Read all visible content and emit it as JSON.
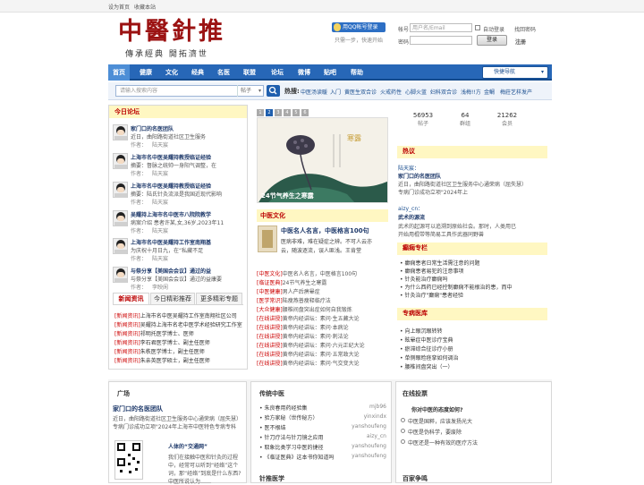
{
  "topbar": {
    "set_home": "设为首页",
    "bookmark": "收藏本站"
  },
  "logo": {
    "main": "中醫針推",
    "slogan": "傳承經典 開拓濟世"
  },
  "login": {
    "qq_button": "用QQ帐号登录",
    "qq_note": "只需一步，快速开始",
    "account_label": "帐号",
    "account_placeholder": "用户名/Email",
    "auto_login": "自动登录",
    "find_password": "找回密码",
    "password_label": "密码",
    "login_button": "登录",
    "register": "注册"
  },
  "nav": {
    "items": [
      "首页",
      "健康",
      "文化",
      "经典",
      "名医",
      "联盟",
      "论坛",
      "微博",
      "贴吧",
      "帮助"
    ],
    "quick_nav": "快捷导航"
  },
  "search": {
    "placeholder": "请输入搜索内容",
    "scope": "帖子",
    "hot_label": "热搜:",
    "hot_words": [
      "中医汤读暖",
      "入门",
      "黄医生双合诊",
      "火戒药性",
      "心脚火蓝",
      "妇科双合诊",
      "浅梅!!方",
      "金鲷",
      "梅莊艺样发产"
    ]
  },
  "today_forum": {
    "title": "今日论坛",
    "posts": [
      {
        "title": "家门口的名医团队",
        "summary": "近日，曲阳路街道社区卫生服务",
        "author_label": "作者：",
        "author": "陆天宸"
      },
      {
        "title": "上海市名中医吴耀持教授临证经验",
        "summary": "摘要：督脉之统帅一身阳气调整，在",
        "author_label": "作者：",
        "author": "陆天宸"
      },
      {
        "title": "上海市名中医吴耀持教授临证经验",
        "summary": "摘要：陆氏针灸流派是我国近现代影响",
        "author_label": "作者：",
        "author": "陆天宸"
      },
      {
        "title": "吴耀持上海市名中医市八院院教学",
        "summary": "病案介绍 患者许某,女,36岁,2023年11",
        "author_label": "作者：",
        "author": "陆天宸"
      },
      {
        "title": "上海市名中医吴耀持工作室南翔基",
        "summary": "为庆祝十月日九，在“私藏不足",
        "author_label": "作者：",
        "author": "陆天宸"
      },
      {
        "title": "与祭分享【美国会会议】通过的益",
        "summary": "与祭分享【美国会会议】通过的益康要",
        "author_label": "作者：",
        "author": "李映阆"
      }
    ]
  },
  "news_tabs": {
    "tabs": [
      "新闻资讯",
      "今日精彩推荐",
      "更多精彩专题"
    ],
    "items": [
      {
        "tag": "[新闻资讯]",
        "text": "上海市名中医吴耀持工作室南翔社区公司"
      },
      {
        "tag": "[新闻资讯]",
        "text": "吴耀持上海市名老中医学术经验研究工作室"
      },
      {
        "tag": "[新闻资讯]",
        "text": "祁明托医学博士、医师"
      },
      {
        "tag": "[新闻资讯]",
        "text": "李石君医学博士、副主任医师"
      },
      {
        "tag": "[新闻资讯]",
        "text": "朱秩医学博士，副主任医师"
      },
      {
        "tag": "[新闻资讯]",
        "text": "朱亲英医学硕士，副主任医师"
      }
    ]
  },
  "slide": {
    "pages": [
      "1",
      "2",
      "3",
      "4",
      "5",
      "6"
    ],
    "active_page": "1",
    "caption": "24节气养生之寒露",
    "season_word": "寒露"
  },
  "culture": {
    "label": "中医文化",
    "headline": "中医名人名言，中医格言100句",
    "excerpt_lines": [
      "医病非难，难在疑症之辨。不可人云亦",
      "云，随波逐流，误人匪浅。王肯堂"
    ]
  },
  "center_list": [
    {
      "tag": "[中医文化]",
      "text": "中医名人名言，中医格言100句"
    },
    {
      "tag": "[临证医典]",
      "text": "24节气养生之寒露"
    },
    {
      "tag": "[中医健康]",
      "text": "男人产后痹晕症"
    },
    {
      "tag": "[医学常识]",
      "text": "陆瘦燕普瘦释临疗法"
    },
    {
      "tag": "[大众健康]",
      "text": "腰椎间盘突出症如何自我锻炼"
    },
    {
      "tag": "[在线讲授]",
      "text": "黄帝内经讲坛：素问·生五藏大论"
    },
    {
      "tag": "[在线讲授]",
      "text": "黄帝内经讲坛：素问·本病论"
    },
    {
      "tag": "[在线讲授]",
      "text": "黄帝内经讲坛：素问·刺法论"
    },
    {
      "tag": "[在线讲授]",
      "text": "黄帝内经讲坛：素问·六元正纪大论"
    },
    {
      "tag": "[在线讲授]",
      "text": "黄帝内经讲坛：素问·五常政大论"
    },
    {
      "tag": "[在线讲授]",
      "text": "黄帝内经讲坛：素问·气交变大论"
    }
  ],
  "stats": [
    {
      "value": "56953",
      "label": "帖子"
    },
    {
      "value": "64",
      "label": "群组"
    },
    {
      "value": "21262",
      "label": "会员"
    }
  ],
  "hot_discussion": {
    "title": "热议",
    "post1": {
      "author": "陆天宸：",
      "title": "家门口的名医团队",
      "lines": [
        "近日，曲阳路街道社区卫生服务中心通荣病（屈失慧）",
        "专病门诊成功立项\"2024年上"
      ]
    },
    "post2": {
      "author": "aizy_cn：",
      "title": "武术的源流",
      "lines": [
        "武术的起源可以追溯到原始社会。那时，人类用已",
        "开始用棍带等简易工具作武器同野兽"
      ]
    }
  },
  "epilepsy": {
    "title": "癫痫专栏",
    "items": [
      "癫痫患者日常生活需注意的问题",
      "癫痫患者易犯的注意事项",
      "针灸能治疗癫痫吗",
      "为什么西药已经控制癫痫不能根治的患，而中",
      "针灸治疗\"癫痫\"患者经验"
    ]
  },
  "special": {
    "title": "专病医库",
    "items": [
      "向上眼沉眼转转",
      "眩晕症中医诊疗宝典",
      "瘀滞综合征诊疗小册",
      "单侧眼睑痉挛如何调治",
      "腰椎间盘突出（一）"
    ]
  },
  "plaza": {
    "title": "广场",
    "post_title": "家门口的名医团队",
    "post_lines": [
      "近日，曲阳路街道社区卫生服务中心通荣病（屈失慧）",
      "专病门诊成功立项\"2024年上海市中医特色专病专科"
    ],
    "sub_title": "人体的“交通网”",
    "sub_lines": [
      "我们在接触中医和针灸的过程",
      "中，经常可以听到“经络”这个",
      "词，那“经络”到底是什么东西?",
      "中医所说认为……"
    ]
  },
  "tcm_spread": {
    "title": "传统中医",
    "items": [
      {
        "text": "朱良春用药经验集",
        "author": "mjb96"
      },
      {
        "text": "验方家秘（世传秘方）",
        "author": "yinxindx"
      },
      {
        "text": "医不根结",
        "author": "yanshoufeng"
      },
      {
        "text": "针刀疗法与针刀镜之应用",
        "author": "aizy_cn"
      },
      {
        "text": "取象比类学习中医的捷径",
        "author": "yanshoufeng"
      },
      {
        "text": "《临证医典》这本书你知道吗",
        "author": "yanshoufeng"
      }
    ],
    "second_title": "针推医学"
  },
  "poll": {
    "title": "在线投票",
    "question": "你对中医的态度如何?",
    "options": [
      "中医是国粹，应该发扬光大",
      "中医是伪科学，要废除",
      "中医还是一种有效的医疗方法"
    ],
    "bottom_title": "百家争鸣"
  }
}
